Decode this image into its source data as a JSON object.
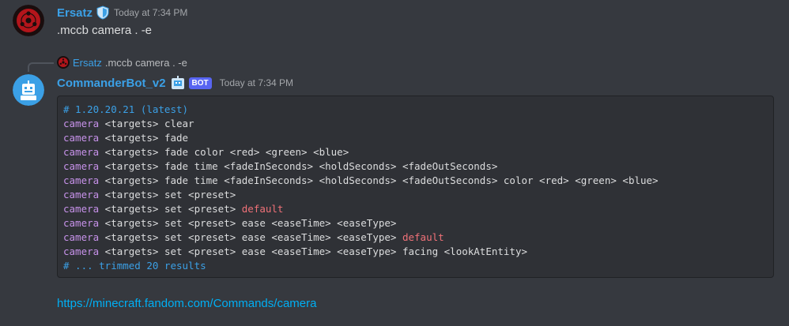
{
  "messages": [
    {
      "author": "Ersatz",
      "author_color": "#3ba0e6",
      "timestamp": "Today at 7:34 PM",
      "text": ".mccb camera . -e",
      "avatar_icon": "sharingan-avatar-icon",
      "badge_icon": "shield-icon"
    },
    {
      "reply": {
        "author": "Ersatz",
        "text": ".mccb camera . -e",
        "avatar_icon": "sharingan-avatar-icon"
      },
      "author": "CommanderBot_v2",
      "author_color": "#3ba0e6",
      "bot_tag": "BOT",
      "timestamp": "Today at 7:34 PM",
      "avatar_icon": "robot-avatar-icon",
      "badge_icon": "robot-badge-icon",
      "code": {
        "lines": [
          [
            {
              "t": "# 1.20.20.21 (latest)",
              "c": "comment"
            }
          ],
          [
            {
              "t": "camera",
              "c": "kw"
            },
            {
              "t": " <targets> clear",
              "c": "plain"
            }
          ],
          [
            {
              "t": "camera",
              "c": "kw"
            },
            {
              "t": " <targets> fade",
              "c": "plain"
            }
          ],
          [
            {
              "t": "camera",
              "c": "kw"
            },
            {
              "t": " <targets> fade color <red> <green> <blue>",
              "c": "plain"
            }
          ],
          [
            {
              "t": "camera",
              "c": "kw"
            },
            {
              "t": " <targets> fade time <fadeInSeconds> <holdSeconds> <fadeOutSeconds>",
              "c": "plain"
            }
          ],
          [
            {
              "t": "camera",
              "c": "kw"
            },
            {
              "t": " <targets> fade time <fadeInSeconds> <holdSeconds> <fadeOutSeconds> color <red> <green> <blue>",
              "c": "plain"
            }
          ],
          [
            {
              "t": "camera",
              "c": "kw"
            },
            {
              "t": " <targets> set <preset>",
              "c": "plain"
            }
          ],
          [
            {
              "t": "camera",
              "c": "kw"
            },
            {
              "t": " <targets> set <preset> ",
              "c": "plain"
            },
            {
              "t": "default",
              "c": "lit"
            }
          ],
          [
            {
              "t": "camera",
              "c": "kw"
            },
            {
              "t": " <targets> set <preset> ease <easeTime> <easeType>",
              "c": "plain"
            }
          ],
          [
            {
              "t": "camera",
              "c": "kw"
            },
            {
              "t": " <targets> set <preset> ease <easeTime> <easeType> ",
              "c": "plain"
            },
            {
              "t": "default",
              "c": "lit"
            }
          ],
          [
            {
              "t": "camera",
              "c": "kw"
            },
            {
              "t": " <targets> set <preset> ease <easeTime> <easeType> facing <lookAtEntity>",
              "c": "plain"
            }
          ],
          [
            {
              "t": "# ... trimmed 20 results",
              "c": "comment"
            }
          ]
        ]
      },
      "link": "https://minecraft.fandom.com/Commands/camera"
    }
  ],
  "colors": {
    "background": "#36393f",
    "codeblock": "#2f3136",
    "link": "#00aff4",
    "bot_tag": "#5865f2",
    "keyword": "#c792ea",
    "literal": "#f07178",
    "comment": "#3ba0e6"
  }
}
